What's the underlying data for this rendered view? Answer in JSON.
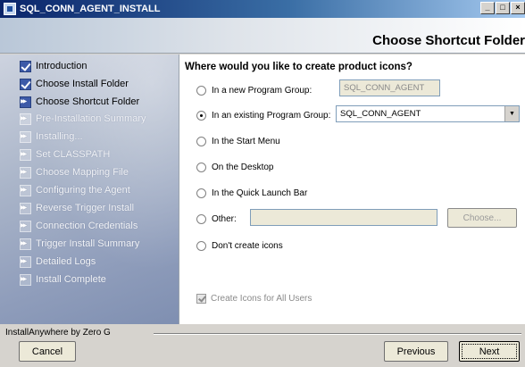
{
  "window": {
    "title": "SQL_CONN_AGENT_INSTALL",
    "minimize_glyph": "_",
    "maximize_glyph": "□",
    "close_glyph": "×"
  },
  "header": {
    "title": "Choose Shortcut Folder"
  },
  "steps": [
    {
      "label": "Introduction",
      "state": "done"
    },
    {
      "label": "Choose Install Folder",
      "state": "done"
    },
    {
      "label": "Choose Shortcut Folder",
      "state": "current"
    },
    {
      "label": "Pre-Installation Summary",
      "state": "pending"
    },
    {
      "label": "Installing...",
      "state": "pending"
    },
    {
      "label": "Set CLASSPATH",
      "state": "pending"
    },
    {
      "label": "Choose Mapping File",
      "state": "pending"
    },
    {
      "label": "Configuring the Agent",
      "state": "pending"
    },
    {
      "label": "Reverse Trigger Install",
      "state": "pending"
    },
    {
      "label": "Connection Credentials",
      "state": "pending"
    },
    {
      "label": "Trigger Install Summary",
      "state": "pending"
    },
    {
      "label": "Detailed Logs",
      "state": "pending"
    },
    {
      "label": "Install Complete",
      "state": "pending"
    }
  ],
  "main": {
    "question": "Where would you like to create product icons?",
    "options": {
      "new_group": {
        "label": "In a new Program Group:",
        "value": "SQL_CONN_AGENT",
        "selected": false
      },
      "existing_group": {
        "label": "In an existing Program Group:",
        "value": "SQL_CONN_AGENT",
        "selected": true
      },
      "start_menu": {
        "label": "In the Start Menu",
        "selected": false
      },
      "desktop": {
        "label": "On the Desktop",
        "selected": false
      },
      "quick_launch": {
        "label": "In the Quick Launch Bar",
        "selected": false
      },
      "other": {
        "label": "Other:",
        "value": "",
        "selected": false
      },
      "none": {
        "label": "Don't create icons",
        "selected": false
      }
    },
    "choose_button": "Choose...",
    "all_users_checkbox": {
      "label": "Create Icons for All Users",
      "checked": true
    }
  },
  "footer": {
    "brand": "InstallAnywhere by Zero G",
    "cancel": "Cancel",
    "previous": "Previous",
    "next": "Next"
  }
}
